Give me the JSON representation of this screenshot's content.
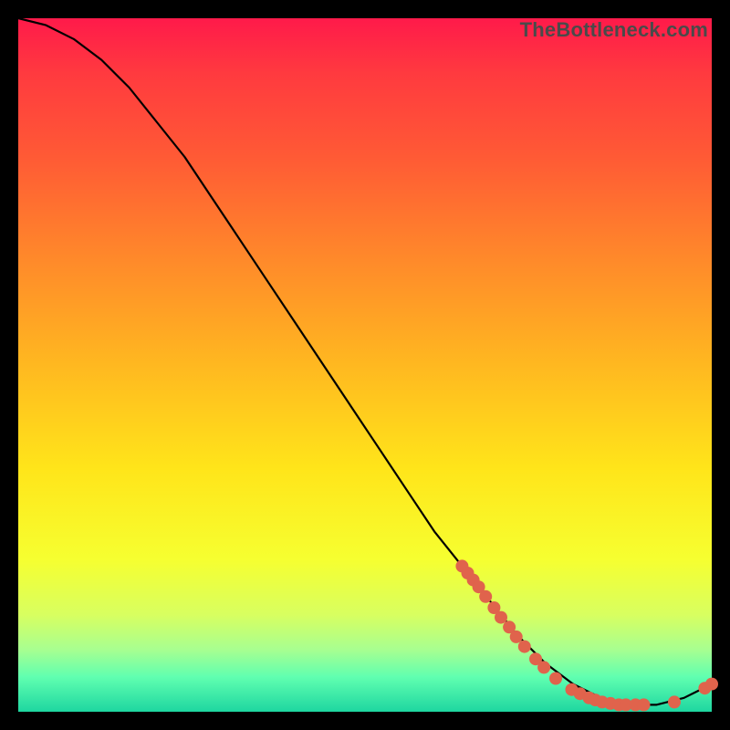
{
  "watermark": "TheBottleneck.com",
  "chart_data": {
    "type": "line",
    "title": "",
    "xlabel": "",
    "ylabel": "",
    "xlim": [
      0,
      100
    ],
    "ylim": [
      0,
      100
    ],
    "grid": false,
    "legend": false,
    "series": [
      {
        "name": "bottleneck-curve",
        "x": [
          0,
          4,
          8,
          12,
          16,
          20,
          24,
          28,
          32,
          36,
          40,
          44,
          48,
          52,
          56,
          60,
          64,
          68,
          72,
          76,
          80,
          84,
          88,
          92,
          96,
          100
        ],
        "y": [
          100,
          99,
          97,
          94,
          90,
          85,
          80,
          74,
          68,
          62,
          56,
          50,
          44,
          38,
          32,
          26,
          21,
          16,
          11,
          7,
          4,
          2,
          1,
          1,
          2,
          4
        ]
      }
    ],
    "scatter_points": {
      "name": "highlighted-points",
      "approx": true,
      "points": [
        {
          "x": 64.0,
          "y": 21.0
        },
        {
          "x": 64.8,
          "y": 20.0
        },
        {
          "x": 65.6,
          "y": 19.0
        },
        {
          "x": 66.4,
          "y": 18.0
        },
        {
          "x": 67.4,
          "y": 16.6
        },
        {
          "x": 68.6,
          "y": 15.0
        },
        {
          "x": 69.6,
          "y": 13.6
        },
        {
          "x": 70.8,
          "y": 12.2
        },
        {
          "x": 71.8,
          "y": 10.8
        },
        {
          "x": 73.0,
          "y": 9.4
        },
        {
          "x": 74.6,
          "y": 7.6
        },
        {
          "x": 75.8,
          "y": 6.4
        },
        {
          "x": 77.5,
          "y": 4.8
        },
        {
          "x": 79.8,
          "y": 3.2
        },
        {
          "x": 81.0,
          "y": 2.6
        },
        {
          "x": 82.3,
          "y": 2.0
        },
        {
          "x": 83.2,
          "y": 1.7
        },
        {
          "x": 84.2,
          "y": 1.4
        },
        {
          "x": 85.4,
          "y": 1.2
        },
        {
          "x": 86.6,
          "y": 1.0
        },
        {
          "x": 87.6,
          "y": 1.0
        },
        {
          "x": 89.0,
          "y": 1.0
        },
        {
          "x": 90.2,
          "y": 1.0
        },
        {
          "x": 94.6,
          "y": 1.4
        },
        {
          "x": 99.0,
          "y": 3.4
        },
        {
          "x": 100.0,
          "y": 4.0
        }
      ]
    },
    "point_style": {
      "color": "#e0634c",
      "radius_px": 7
    }
  }
}
